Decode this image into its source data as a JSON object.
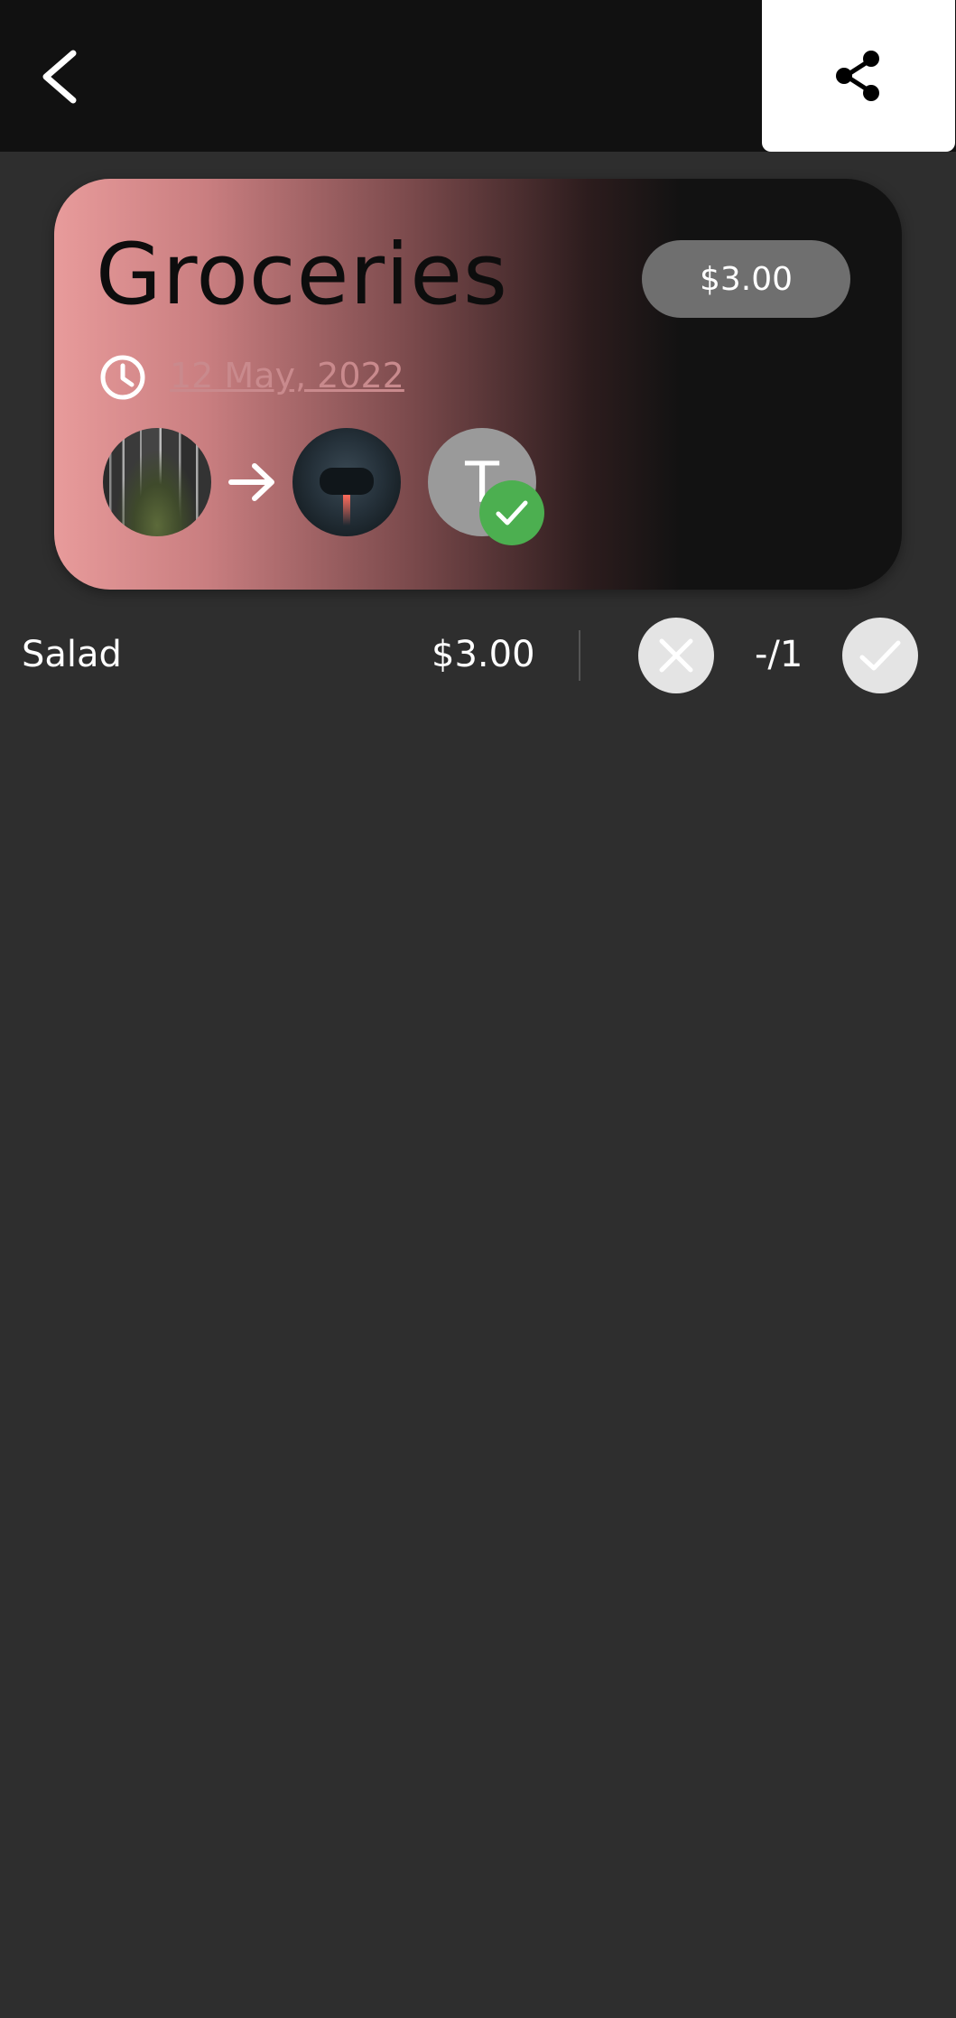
{
  "header": {
    "back_icon": "chevron-left-icon",
    "share_icon": "share-icon"
  },
  "card": {
    "title": "Groceries",
    "amount": "$3.00",
    "date": "12 May, 2022",
    "clock_icon": "clock-icon",
    "arrow_icon": "arrow-right-icon",
    "participant_letter": "T",
    "colors": {
      "gradient_start": "#e89b9b",
      "gradient_end": "#121212",
      "check_badge": "#4caf50"
    }
  },
  "items": [
    {
      "name": "Salad",
      "price": "$3.00",
      "quantity": "-/1"
    }
  ]
}
